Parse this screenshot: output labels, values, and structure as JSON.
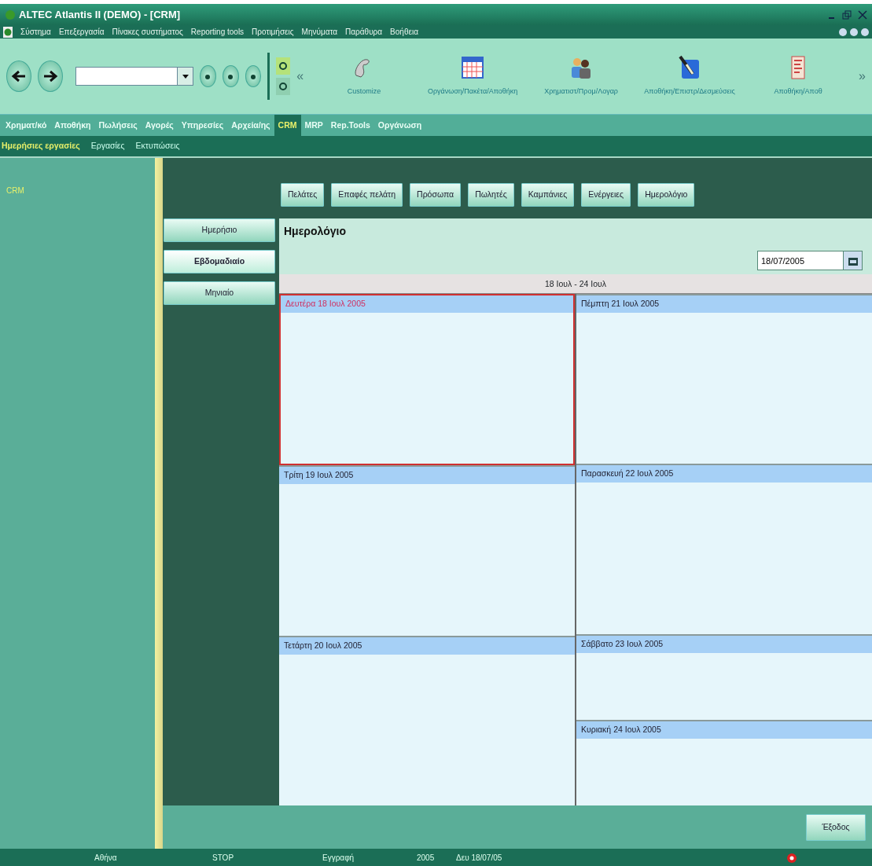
{
  "window": {
    "title": "ALTEC Atlantis II (DEMO) - [CRM]"
  },
  "menu": [
    "Σύστημα",
    "Επεξεργασία",
    "Πίνακες συστήματος",
    "Reporting tools",
    "Προτιμήσεις",
    "Μηνύματα",
    "Παράθυρα",
    "Βοήθεια"
  ],
  "toolbar": {
    "overflow_left": "«",
    "overflow_right": "»",
    "shortcuts": [
      {
        "kind": "phone",
        "label": "Customize"
      },
      {
        "kind": "calendar",
        "label": "Οργάνωση/Πακέτα/Αποθήκη"
      },
      {
        "kind": "people",
        "label": "Χρηματιστ/Προμ/Λογαρ"
      },
      {
        "kind": "tools",
        "label": "Αποθήκη/Επιστρ/Δεσμεύσεις"
      },
      {
        "kind": "report",
        "label": "Αποθήκη/Αποθ"
      }
    ]
  },
  "modules": [
    {
      "label": "Χρηματ/κό",
      "selected": false
    },
    {
      "label": "Αποθήκη",
      "selected": false
    },
    {
      "label": "Πωλήσεις",
      "selected": false
    },
    {
      "label": "Αγορές",
      "selected": false
    },
    {
      "label": "Υπηρεσίες",
      "selected": false
    },
    {
      "label": "Αρχεία/ης",
      "selected": false
    },
    {
      "label": "CRM",
      "selected": true
    },
    {
      "label": "MRP",
      "selected": false
    },
    {
      "label": "Rep.Tools",
      "selected": false
    },
    {
      "label": "Οργάνωση",
      "selected": false
    }
  ],
  "subtabs": [
    {
      "label": "Ημερήσιες εργασίες",
      "selected": true
    },
    {
      "label": "Εργασίες",
      "selected": false
    },
    {
      "label": "Εκτυπώσεις",
      "selected": false
    }
  ],
  "sidebar": {
    "items": [
      "CRM"
    ]
  },
  "top_buttons": [
    "Πελάτες",
    "Επαφές πελάτη",
    "Πρόσωπα",
    "Πωλητές",
    "Καμπάνιες",
    "Ενέργειες",
    "Ημερολόγιο"
  ],
  "view_buttons": [
    {
      "label": "Ημερήσιο",
      "selected": false
    },
    {
      "label": "Εβδομαδιαίο",
      "selected": true
    },
    {
      "label": "Μηνιαίο",
      "selected": false
    }
  ],
  "calendar": {
    "title": "Ημερολόγιο",
    "date": "18/07/2005",
    "range": "18 Ιουλ - 24 Ιουλ",
    "days": [
      {
        "label": "Δευτέρα 18 Ιουλ 2005",
        "kind": "weekday",
        "selected": true
      },
      {
        "label": "Τρίτη 19 Ιουλ 2005",
        "kind": "weekday",
        "selected": false
      },
      {
        "label": "Τετάρτη 20 Ιουλ 2005",
        "kind": "weekday",
        "selected": false
      },
      {
        "label": "Πέμπτη 21 Ιουλ 2005",
        "kind": "weekday",
        "selected": false
      },
      {
        "label": "Παρασκευή 22 Ιουλ 2005",
        "kind": "weekday",
        "selected": false
      },
      {
        "label": "Σάββατο 23 Ιουλ 2005",
        "kind": "weekend",
        "selected": false
      },
      {
        "label": "Κυριακή 24 Ιουλ 2005",
        "kind": "weekend",
        "selected": false
      }
    ]
  },
  "exit_button": "Έξοδος",
  "status_bar": [
    "Αθήνα",
    "STOP",
    "Εγγραφή",
    "2005",
    "Δευ 18/07/05"
  ]
}
